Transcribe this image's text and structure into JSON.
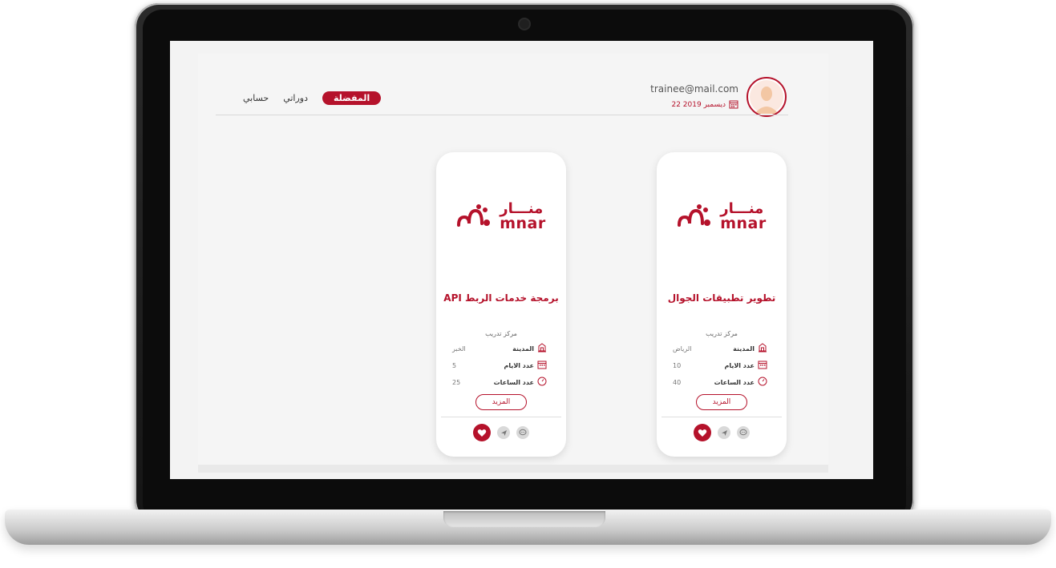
{
  "header": {
    "email": "trainee@mail.com",
    "date": "22 ديسمبر 2019",
    "nav": [
      {
        "label": "المفضلة",
        "active": true
      },
      {
        "label": "دوراتي",
        "active": false
      },
      {
        "label": "حسابي",
        "active": false
      }
    ]
  },
  "cards": [
    {
      "logo_ar": "منـــار",
      "logo_en": "mnar",
      "title": "تطوير تطبيقات الجوال",
      "subtitle": "مركز تدريب",
      "city_label": "المدينة",
      "city": "الرياض",
      "days_label": "عدد الايام",
      "days": "10",
      "hours_label": "عدد الساعات",
      "hours": "40",
      "more": "المزيد"
    },
    {
      "logo_ar": "منـــار",
      "logo_en": "mnar",
      "title": "برمجة خدمات الربط API",
      "subtitle": "مركز تدريب",
      "city_label": "المدينة",
      "city": "الخبر",
      "days_label": "عدد الايام",
      "days": "5",
      "hours_label": "عدد الساعات",
      "hours": "25",
      "more": "المزيد"
    }
  ],
  "icons": {
    "calendar": "calendar-icon",
    "avatar": "user-avatar",
    "city": "building-icon",
    "hours": "clock-icon",
    "favorite": "heart-icon",
    "share": "send-icon",
    "chat": "chat-icon"
  },
  "colors": {
    "accent": "#b5122b",
    "background": "#f5f5f5"
  }
}
